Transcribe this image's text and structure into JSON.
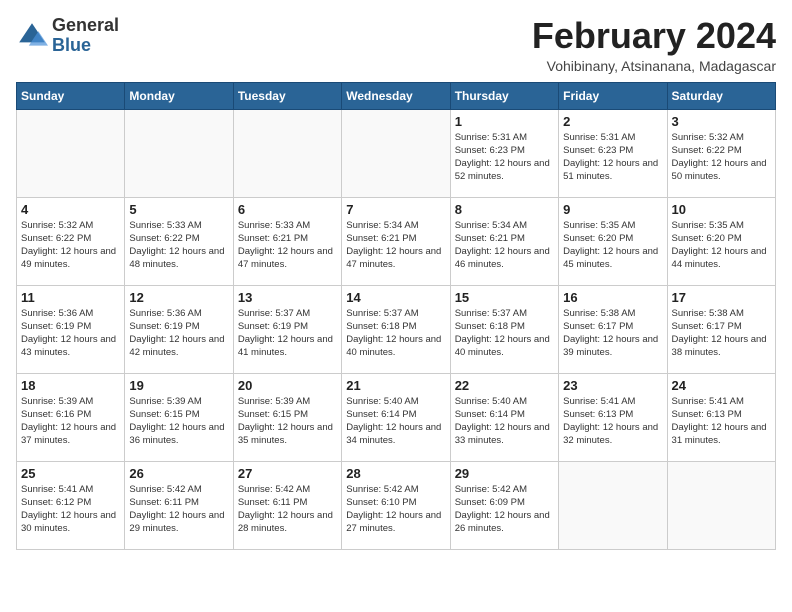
{
  "logo": {
    "general": "General",
    "blue": "Blue"
  },
  "header": {
    "month": "February 2024",
    "location": "Vohibinany, Atsinanana, Madagascar"
  },
  "weekdays": [
    "Sunday",
    "Monday",
    "Tuesday",
    "Wednesday",
    "Thursday",
    "Friday",
    "Saturday"
  ],
  "weeks": [
    [
      {
        "day": "",
        "info": ""
      },
      {
        "day": "",
        "info": ""
      },
      {
        "day": "",
        "info": ""
      },
      {
        "day": "",
        "info": ""
      },
      {
        "day": "1",
        "info": "Sunrise: 5:31 AM\nSunset: 6:23 PM\nDaylight: 12 hours\nand 52 minutes."
      },
      {
        "day": "2",
        "info": "Sunrise: 5:31 AM\nSunset: 6:23 PM\nDaylight: 12 hours\nand 51 minutes."
      },
      {
        "day": "3",
        "info": "Sunrise: 5:32 AM\nSunset: 6:22 PM\nDaylight: 12 hours\nand 50 minutes."
      }
    ],
    [
      {
        "day": "4",
        "info": "Sunrise: 5:32 AM\nSunset: 6:22 PM\nDaylight: 12 hours\nand 49 minutes."
      },
      {
        "day": "5",
        "info": "Sunrise: 5:33 AM\nSunset: 6:22 PM\nDaylight: 12 hours\nand 48 minutes."
      },
      {
        "day": "6",
        "info": "Sunrise: 5:33 AM\nSunset: 6:21 PM\nDaylight: 12 hours\nand 47 minutes."
      },
      {
        "day": "7",
        "info": "Sunrise: 5:34 AM\nSunset: 6:21 PM\nDaylight: 12 hours\nand 47 minutes."
      },
      {
        "day": "8",
        "info": "Sunrise: 5:34 AM\nSunset: 6:21 PM\nDaylight: 12 hours\nand 46 minutes."
      },
      {
        "day": "9",
        "info": "Sunrise: 5:35 AM\nSunset: 6:20 PM\nDaylight: 12 hours\nand 45 minutes."
      },
      {
        "day": "10",
        "info": "Sunrise: 5:35 AM\nSunset: 6:20 PM\nDaylight: 12 hours\nand 44 minutes."
      }
    ],
    [
      {
        "day": "11",
        "info": "Sunrise: 5:36 AM\nSunset: 6:19 PM\nDaylight: 12 hours\nand 43 minutes."
      },
      {
        "day": "12",
        "info": "Sunrise: 5:36 AM\nSunset: 6:19 PM\nDaylight: 12 hours\nand 42 minutes."
      },
      {
        "day": "13",
        "info": "Sunrise: 5:37 AM\nSunset: 6:19 PM\nDaylight: 12 hours\nand 41 minutes."
      },
      {
        "day": "14",
        "info": "Sunrise: 5:37 AM\nSunset: 6:18 PM\nDaylight: 12 hours\nand 40 minutes."
      },
      {
        "day": "15",
        "info": "Sunrise: 5:37 AM\nSunset: 6:18 PM\nDaylight: 12 hours\nand 40 minutes."
      },
      {
        "day": "16",
        "info": "Sunrise: 5:38 AM\nSunset: 6:17 PM\nDaylight: 12 hours\nand 39 minutes."
      },
      {
        "day": "17",
        "info": "Sunrise: 5:38 AM\nSunset: 6:17 PM\nDaylight: 12 hours\nand 38 minutes."
      }
    ],
    [
      {
        "day": "18",
        "info": "Sunrise: 5:39 AM\nSunset: 6:16 PM\nDaylight: 12 hours\nand 37 minutes."
      },
      {
        "day": "19",
        "info": "Sunrise: 5:39 AM\nSunset: 6:15 PM\nDaylight: 12 hours\nand 36 minutes."
      },
      {
        "day": "20",
        "info": "Sunrise: 5:39 AM\nSunset: 6:15 PM\nDaylight: 12 hours\nand 35 minutes."
      },
      {
        "day": "21",
        "info": "Sunrise: 5:40 AM\nSunset: 6:14 PM\nDaylight: 12 hours\nand 34 minutes."
      },
      {
        "day": "22",
        "info": "Sunrise: 5:40 AM\nSunset: 6:14 PM\nDaylight: 12 hours\nand 33 minutes."
      },
      {
        "day": "23",
        "info": "Sunrise: 5:41 AM\nSunset: 6:13 PM\nDaylight: 12 hours\nand 32 minutes."
      },
      {
        "day": "24",
        "info": "Sunrise: 5:41 AM\nSunset: 6:13 PM\nDaylight: 12 hours\nand 31 minutes."
      }
    ],
    [
      {
        "day": "25",
        "info": "Sunrise: 5:41 AM\nSunset: 6:12 PM\nDaylight: 12 hours\nand 30 minutes."
      },
      {
        "day": "26",
        "info": "Sunrise: 5:42 AM\nSunset: 6:11 PM\nDaylight: 12 hours\nand 29 minutes."
      },
      {
        "day": "27",
        "info": "Sunrise: 5:42 AM\nSunset: 6:11 PM\nDaylight: 12 hours\nand 28 minutes."
      },
      {
        "day": "28",
        "info": "Sunrise: 5:42 AM\nSunset: 6:10 PM\nDaylight: 12 hours\nand 27 minutes."
      },
      {
        "day": "29",
        "info": "Sunrise: 5:42 AM\nSunset: 6:09 PM\nDaylight: 12 hours\nand 26 minutes."
      },
      {
        "day": "",
        "info": ""
      },
      {
        "day": "",
        "info": ""
      }
    ]
  ]
}
